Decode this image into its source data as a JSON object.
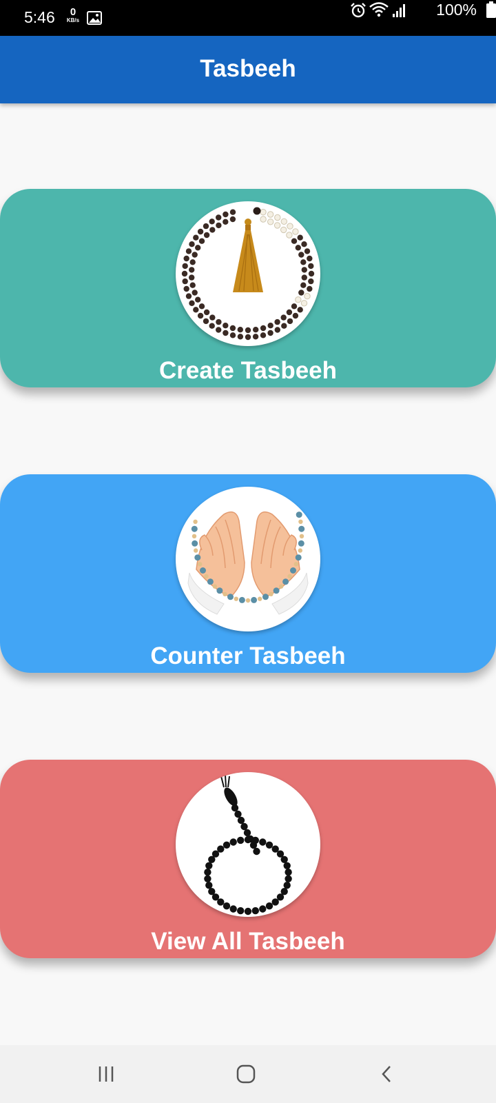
{
  "status_bar": {
    "time": "5:46",
    "net_speed_value": "0",
    "net_speed_unit": "KB/s",
    "battery": "100%"
  },
  "app_bar": {
    "title": "Tasbeeh"
  },
  "cards": [
    {
      "label": "Create Tasbeeh",
      "color": "#4db6ac",
      "icon": "tasbeeh-beads-tassel-icon"
    },
    {
      "label": "Counter Tasbeeh",
      "color": "#42a5f5",
      "icon": "praying-hands-beads-icon"
    },
    {
      "label": "View All Tasbeeh",
      "color": "#e57373",
      "icon": "hanging-beads-icon"
    }
  ],
  "colors": {
    "app_bar": "#1565c0",
    "background": "#f8f8f8"
  },
  "nav_bar": {
    "icons": [
      "recent-apps-icon",
      "home-icon",
      "back-icon"
    ]
  }
}
